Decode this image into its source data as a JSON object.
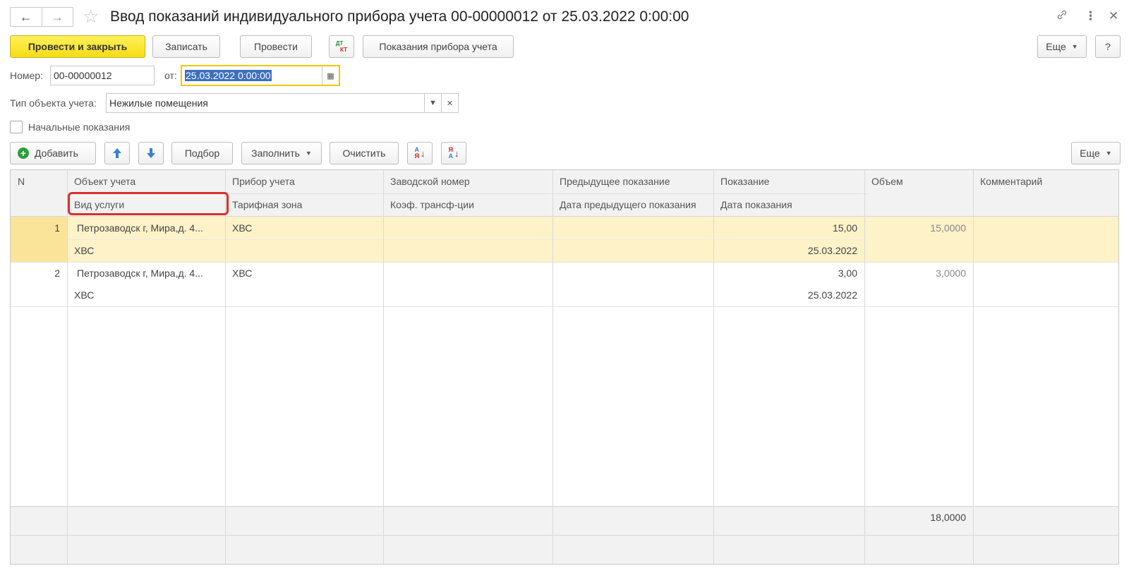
{
  "window": {
    "title": "Ввод показаний индивидуального прибора учета 00-00000012 от 25.03.2022 0:00:00",
    "nav_back_icon": "arrow-left-icon",
    "nav_forward_icon": "arrow-right-icon",
    "favorite_icon": "star-icon",
    "link_icon": "link-icon",
    "more_icon": "kebab-menu-icon",
    "close_icon": "close-icon"
  },
  "toolbar": {
    "post_close": "Провести и закрыть",
    "save": "Записать",
    "post": "Провести",
    "dtkt_top": "ДТ",
    "dtkt_bottom": "КТ",
    "readings": "Показания прибора учета",
    "more": "Еще",
    "help": "?"
  },
  "form": {
    "number_label": "Номер:",
    "number_value": "00-00000012",
    "date_label": "от:",
    "date_value": "25.03.2022  0:00:00",
    "type_label": "Тип объекта учета:",
    "type_value": "Нежилые помещения",
    "initial_label": "Начальные показания"
  },
  "table_toolbar": {
    "add": "Добавить",
    "pick": "Подбор",
    "fill": "Заполнить",
    "clear": "Очистить",
    "sort_asc_top": "А",
    "sort_asc_bottom": "Я",
    "sort_desc_top": "Я",
    "sort_desc_bottom": "А",
    "more": "Еще"
  },
  "table": {
    "headers": {
      "n": "N",
      "object": "Объект учета",
      "service": "Вид услуги",
      "meter": "Прибор учета",
      "zone": "Тарифная зона",
      "serial": "Заводской номер",
      "coef": "Коэф. трансф-ции",
      "prev": "Предыдущее показание",
      "prev_date": "Дата предыдущего показания",
      "reading": "Показание",
      "reading_date": "Дата показания",
      "volume": "Объем",
      "comment": "Комментарий"
    },
    "rows": [
      {
        "n": "1",
        "object": "Петрозаводск г, Мира,д. 4...",
        "meter": "ХВС",
        "service": "ХВС",
        "reading": "15,00",
        "reading_date": "25.03.2022",
        "volume": "15,0000"
      },
      {
        "n": "2",
        "object": "Петрозаводск г, Мира,д. 4...",
        "meter": "ХВС",
        "service": "ХВС",
        "reading": "3,00",
        "reading_date": "25.03.2022",
        "volume": "3,0000"
      }
    ],
    "total_volume": "18,0000"
  }
}
